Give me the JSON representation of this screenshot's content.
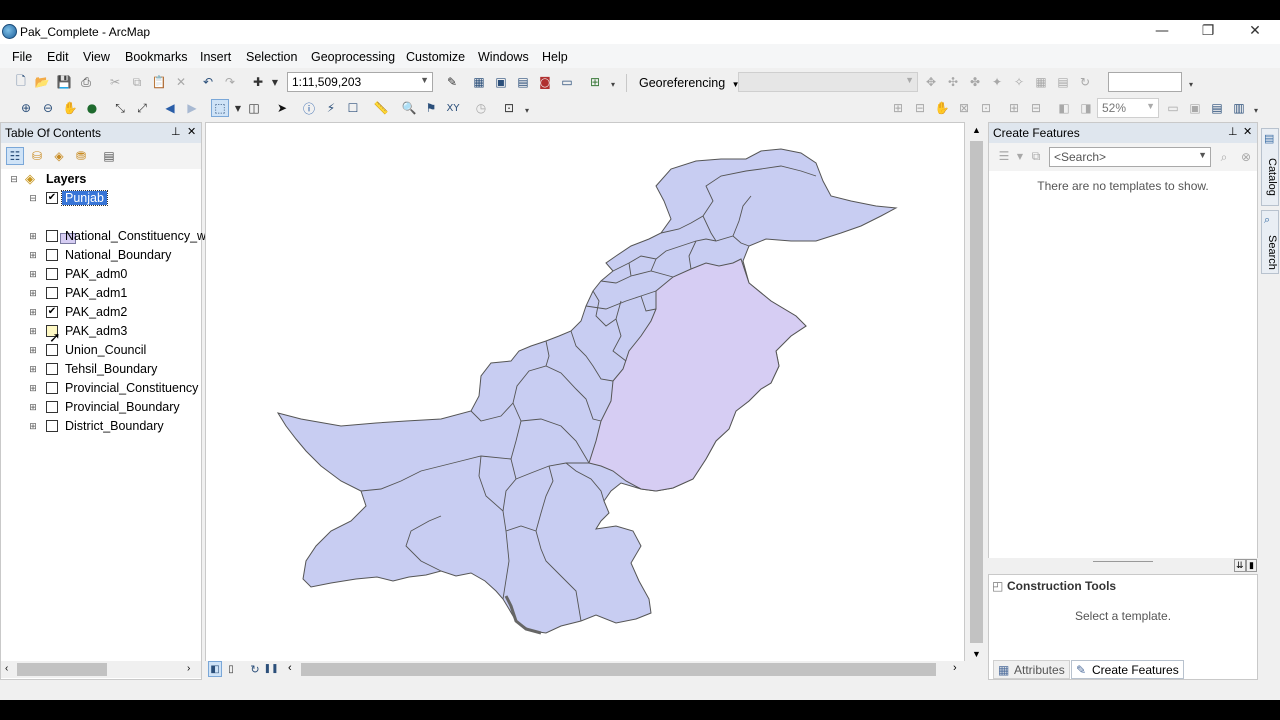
{
  "window": {
    "title": "Pak_Complete - ArcMap",
    "minimize": "—",
    "restore": "❐",
    "close": "✕"
  },
  "menu": [
    "File",
    "Edit",
    "View",
    "Bookmarks",
    "Insert",
    "Selection",
    "Geoprocessing",
    "Customize",
    "Windows",
    "Help"
  ],
  "toolbar": {
    "scale": "1:11,509,203",
    "georeferencing_label": "Georeferencing",
    "zoom_level": "52%"
  },
  "toc": {
    "title": "Table Of Contents",
    "root": "Layers",
    "layers": [
      {
        "name": "Punjab",
        "checked": true,
        "selected": true,
        "expanded": true
      },
      {
        "name": "National_Constituency_w",
        "checked": false
      },
      {
        "name": "National_Boundary",
        "checked": false
      },
      {
        "name": "PAK_adm0",
        "checked": false
      },
      {
        "name": "PAK_adm1",
        "checked": false
      },
      {
        "name": "PAK_adm2",
        "checked": true
      },
      {
        "name": "PAK_adm3",
        "checked": false
      },
      {
        "name": "Union_Council",
        "checked": false
      },
      {
        "name": "Tehsil_Boundary",
        "checked": false
      },
      {
        "name": "Provincial_Constituency",
        "checked": false
      },
      {
        "name": "Provincial_Boundary",
        "checked": false
      },
      {
        "name": "District_Boundary",
        "checked": false
      }
    ]
  },
  "map": {
    "country_fill": "#c8cdf2",
    "punjab_fill": "#d6cdf3",
    "outline": "#555555"
  },
  "create_features": {
    "title": "Create Features",
    "search_placeholder": "<Search>",
    "empty_message": "There are no templates to show."
  },
  "construction_tools": {
    "title": "Construction Tools",
    "message": "Select a template."
  },
  "bottom_tabs": {
    "attributes": "Attributes",
    "create_features": "Create Features"
  },
  "side_tabs": {
    "catalog": "Catalog",
    "search": "Search"
  }
}
